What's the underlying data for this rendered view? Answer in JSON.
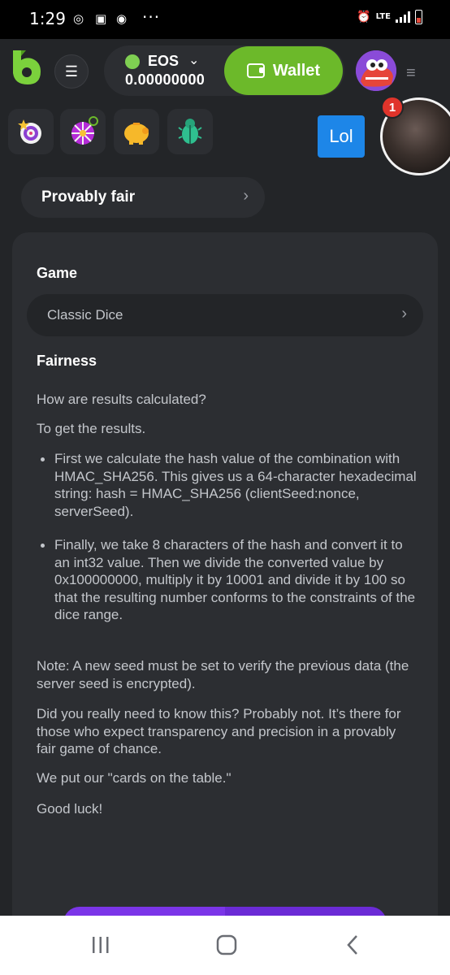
{
  "status_bar": {
    "time": "1:29",
    "network": "LTE",
    "more": "···"
  },
  "header": {
    "currency": "EOS",
    "balance": "0.00000000",
    "wallet_label": "Wallet"
  },
  "chat": {
    "bubble_text": "Lol",
    "unread_count": "1"
  },
  "breadcrumb_pill": {
    "label": "Provably fair"
  },
  "content": {
    "game_heading": "Game",
    "game_select_value": "Classic Dice",
    "fairness_heading": "Fairness",
    "question": "How are results calculated?",
    "intro": "To get the results.",
    "bullets": [
      "First we calculate the hash value of the combination with HMAC_SHA256. This gives us a 64-character hexadecimal string: hash = HMAC_SHA256 (clientSeed:nonce, serverSeed).",
      "Finally, we take 8 characters of the hash and convert it to an int32 value. Then we divide the converted value by 0x100000000, multiply it by 10001 and divide it by 100 so that the resulting number conforms to the constraints of the dice range."
    ],
    "note": "Note: A new seed must be set to verify the previous data (the server seed is encrypted).",
    "did_you": "Did you really need to know this? Probably not. It’s there for those who expect transparency and precision in a provably fair game of chance.",
    "cards": "We put our \"cards on the table.\"",
    "good_luck": "Good luck!"
  },
  "colors": {
    "background": "#232528",
    "card": "#2c2e32",
    "accent_green": "#6cb92a",
    "accent_purple": "#7b35e8",
    "chat_blue": "#1d86e8",
    "badge_red": "#e0342b"
  },
  "icons": [
    "bcgame-logo-icon",
    "hamburger-icon",
    "eos-icon",
    "chevron-down-icon",
    "wallet-icon",
    "avatar",
    "user-menu-icon",
    "target-icon",
    "wheel-icon",
    "piggy-bank-icon",
    "bug-icon",
    "chevron-right-icon",
    "recents-icon",
    "home-icon",
    "back-icon"
  ]
}
